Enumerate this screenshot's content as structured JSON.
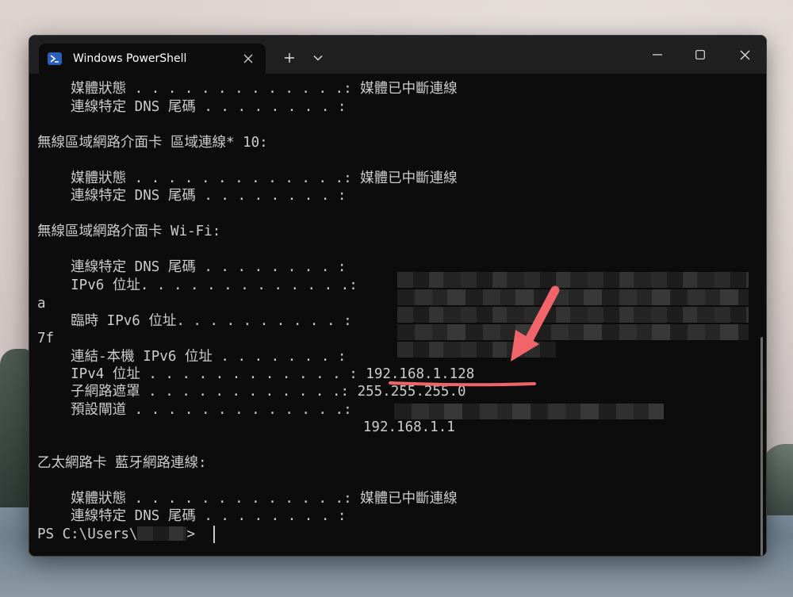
{
  "window": {
    "tab_title": "Windows PowerShell",
    "tab_icon": "powershell-icon",
    "new_tab_symbol": "+",
    "accent": "#2a5fb8"
  },
  "terminal": {
    "lines": [
      "    媒體狀態 . . . . . . . . . . . . .: 媒體已中斷連線",
      "    連線特定 DNS 尾碼 . . . . . . . . :",
      "",
      "無線區域網路介面卡 區域連線* 10:",
      "",
      "    媒體狀態 . . . . . . . . . . . . .: 媒體已中斷連線",
      "    連線特定 DNS 尾碼 . . . . . . . . :",
      "",
      "無線區域網路介面卡 Wi-Fi:",
      "",
      "    連線特定 DNS 尾碼 . . . . . . . . :",
      "    IPv6 位址. . . . . . . . . . . . .:",
      "a",
      "    臨時 IPv6 位址. . . . . . . . . . :",
      "7f",
      "    連結-本機 IPv6 位址 . . . . . . . :",
      "    IPv4 位址 . . . . . . . . . . . . : 192.168.1.128",
      "    子網路遮罩 . . . . . . . . . . . .: 255.255.255.0",
      "    預設閘道 . . . . . . . . . . . . .:",
      "                                       192.168.1.1",
      "",
      "乙太網路卡 藍牙網路連線:",
      "",
      "    媒體狀態 . . . . . . . . . . . . .: 媒體已中斷連線",
      "    連線特定 DNS 尾碼 . . . . . . . . :"
    ],
    "prompt_prefix": "PS C:\\Users\\",
    "prompt_suffix": ">",
    "fg_color": "#cccccc",
    "bg_color": "#0c0c0c"
  },
  "annotation": {
    "color": "#f0646a",
    "highlight": "192.168.1.128"
  }
}
